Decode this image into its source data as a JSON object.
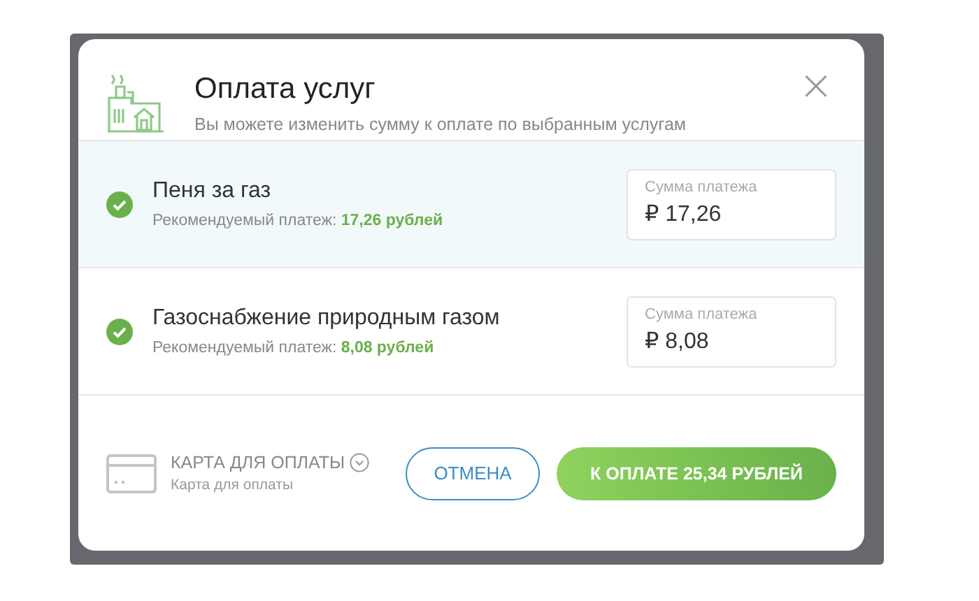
{
  "dialog": {
    "title": "Оплата услуг",
    "subtitle": "Вы можете изменить сумму к оплате по выбранным услугам",
    "close": "×"
  },
  "services": [
    {
      "name": "Пеня за газ",
      "hint_label": "Рекомендуемый платеж:",
      "hint_amount": "17,26 рублей",
      "checked": true,
      "selected": true,
      "field_label": "Сумма платежа",
      "value": "₽ 17,26"
    },
    {
      "name": "Газоснабжение природным газом",
      "hint_label": "Рекомендуемый платеж:",
      "hint_amount": "8,08 рублей",
      "checked": true,
      "selected": false,
      "field_label": "Сумма платежа",
      "value": "₽ 8,08"
    }
  ],
  "footer": {
    "card_title": "КАРТА ДЛЯ ОПЛАТЫ",
    "card_subtitle": "Карта для оплаты",
    "cancel": "ОТМЕНА",
    "pay": "К ОПЛАТЕ 25,34 РУБЛЕЙ"
  }
}
